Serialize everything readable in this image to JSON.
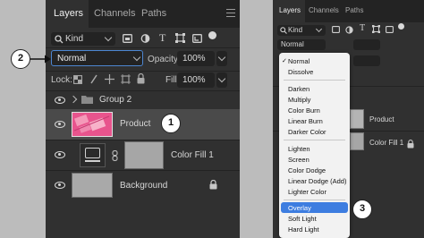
{
  "left_panel": {
    "tabs": [
      {
        "label": "Layers",
        "active": true
      },
      {
        "label": "Channels",
        "active": false
      },
      {
        "label": "Paths",
        "active": false
      }
    ],
    "filter": {
      "label": "Kind"
    },
    "blend_mode": "Normal",
    "opacity": {
      "label": "Opacity:",
      "value": "100%"
    },
    "lock_label": "Lock:",
    "fill": {
      "label": "Fill:",
      "value": "100%"
    },
    "layers": [
      {
        "name": "Group 2",
        "type": "group"
      },
      {
        "name": "Product",
        "type": "image",
        "selected": true
      },
      {
        "name": "Color Fill 1",
        "type": "fill"
      },
      {
        "name": "Background",
        "type": "background",
        "locked": true
      }
    ]
  },
  "annotations": {
    "badge_1": "1",
    "badge_2": "2",
    "badge_3": "3"
  },
  "right_panel": {
    "tabs": [
      {
        "label": "Layers",
        "active": true
      },
      {
        "label": "Channels",
        "active": false
      },
      {
        "label": "Paths",
        "active": false
      }
    ],
    "filter": {
      "label": "Kind"
    },
    "blend_mode": "Normal",
    "layer_names": [
      "Product",
      "Color Fill 1"
    ]
  },
  "dropdown": {
    "checked_item": "Normal",
    "groups": [
      [
        "Normal",
        "Dissolve"
      ],
      [
        "Darken",
        "Multiply",
        "Color Burn",
        "Linear Burn",
        "Darker Color"
      ],
      [
        "Lighten",
        "Screen",
        "Color Dodge",
        "Linear Dodge (Add)",
        "Lighter Color"
      ],
      [
        "Overlay",
        "Soft Light",
        "Hard Light"
      ]
    ],
    "highlighted_item": "Overlay"
  },
  "colors": {
    "panel_bg": "#303030",
    "field_bg": "#232323",
    "accent_blue": "#4c86d1",
    "highlight_blue": "#3d7de0",
    "product_pink": "#e8548d",
    "backdrop": "#bcbcbc"
  }
}
